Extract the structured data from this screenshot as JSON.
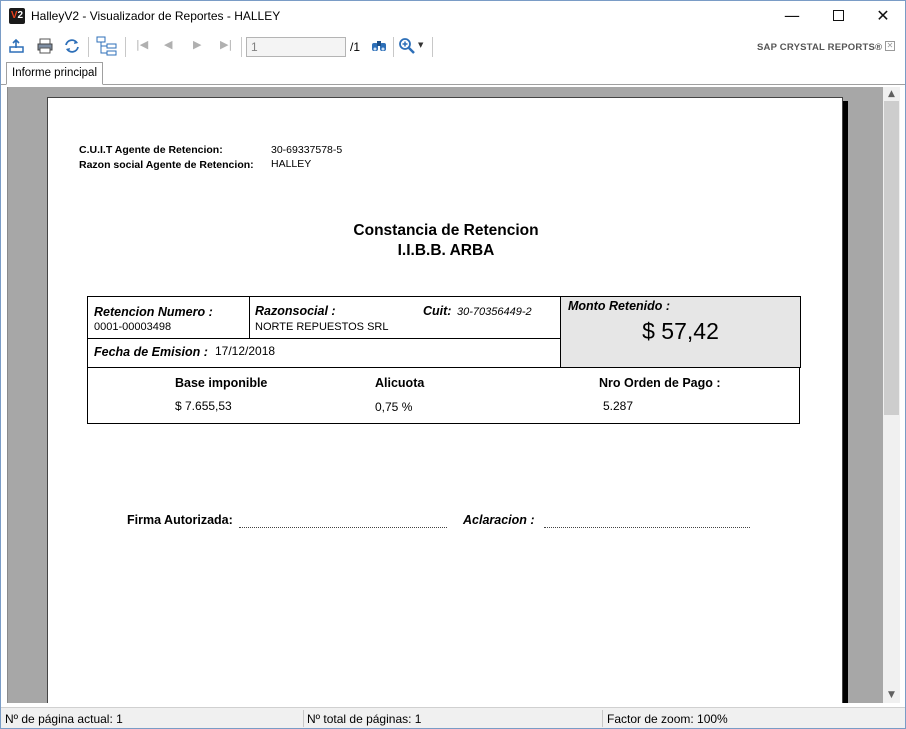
{
  "window": {
    "title": "HalleyV2 - Visualizador de Reportes - HALLEY",
    "icon_text": "V2"
  },
  "toolbar": {
    "page_input_value": "1",
    "page_total": "/1",
    "brand": "SAP CRYSTAL REPORTS®",
    "icons": [
      "export-icon",
      "print-icon",
      "refresh-icon",
      "group-tree-icon",
      "first-page-icon",
      "prev-page-icon",
      "next-page-icon",
      "last-page-icon",
      "find-icon",
      "zoom-icon"
    ]
  },
  "tabs": [
    {
      "label": "Informe principal",
      "active": true
    }
  ],
  "report": {
    "cuit_agent_label": "C.U.I.T Agente de Retencion:",
    "cuit_agent_value": "30-69337578-5",
    "razon_agent_label": "Razon social Agente de Retencion:",
    "razon_agent_value": "HALLEY",
    "title_line1": "Constancia de Retencion",
    "title_line2": "I.I.B.B. ARBA",
    "retencion_numero_label": "Retencion Numero :",
    "retencion_numero_value": "0001-00003498",
    "razonsocial_label": "Razonsocial :",
    "razonsocial_value": "NORTE REPUESTOS SRL",
    "cuit_label": "Cuit:",
    "cuit_value": "30-70356449-2",
    "monto_label": "Monto Retenido :",
    "monto_value": "$ 57,42",
    "fecha_label": "Fecha de Emision :",
    "fecha_value": "17/12/2018",
    "base_label": "Base imponible",
    "base_value": "$  7.655,53",
    "alicuota_label": "Alicuota",
    "alicuota_value": "0,75 %",
    "orden_label": "Nro Orden de Pago :",
    "orden_value": "5.287",
    "firma_label": "Firma Autorizada:",
    "aclaracion_label": "Aclaracion :"
  },
  "status": {
    "current_page": "Nº de página actual: 1",
    "total_pages": "Nº total de páginas: 1",
    "zoom": "Factor de zoom: 100%"
  },
  "colors": {
    "window_border": "#7a9cc6",
    "viewer_bg": "#a7a7a7",
    "monto_bg": "#e6e6e6",
    "icon_blue": "#2d6fb8"
  }
}
